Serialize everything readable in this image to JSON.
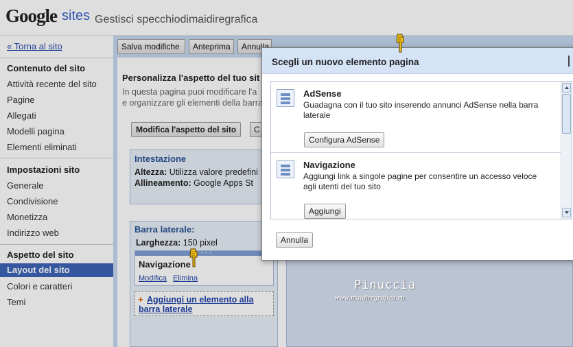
{
  "header": {
    "logo_brand": "Google",
    "logo_product": "sites",
    "site_title": "Gestisci specchiodimaidiregrafica"
  },
  "sidebar": {
    "back_link": "« Torna al sito",
    "content_heading": "Contenuto del sito",
    "content_items": [
      "Attività recente del sito",
      "Pagine",
      "Allegati",
      "Modelli pagina",
      "Elementi eliminati"
    ],
    "settings_heading": "Impostazioni sito",
    "settings_items": [
      "Generale",
      "Condivisione",
      "Monetizza",
      "Indirizzo web"
    ],
    "appearance_heading": "Aspetto del sito",
    "appearance_items": [
      "Layout del sito",
      "Colori e caratteri",
      "Temi"
    ],
    "active_item": "Layout del sito"
  },
  "toolbar": {
    "save_label": "Salva modifiche",
    "preview_label": "Anteprima",
    "cancel_label": "Annulla"
  },
  "layout_page": {
    "title": "Personalizza l'aspetto del tuo sit",
    "description_line1": "In questa pagina puoi modificare l'a",
    "description_line2": "e organizzare gli elementi della barra",
    "modify_button": "Modifica l'aspetto del sito",
    "modify_button2": "C",
    "header_box": {
      "title": "Intestazione",
      "height_label": "Altezza:",
      "height_value": "Utilizza valore predefini",
      "alignment_label": "Allineamento:",
      "alignment_value": "Google Apps St"
    },
    "sidebar_box": {
      "title": "Barra laterale:",
      "width_label": "Larghezza:",
      "width_value": "150 pixel",
      "gadget_title": "Navigazione",
      "gadget_edit": "Modifica",
      "gadget_delete": "Elimina",
      "add_item": "Aggiungi un elemento alla barra laterale"
    }
  },
  "watermark": {
    "name": "Pinuccia",
    "url": "www.maidiregrafica.eu"
  },
  "dialog": {
    "title": "Scegli un nuovo elemento pagina",
    "items": [
      {
        "title": "AdSense",
        "description": "Guadagna con il tuo sito inserendo annunci AdSense nella barra laterale",
        "button": "Configura AdSense"
      },
      {
        "title": "Navigazione",
        "description": "Aggiungi link a singole pagine per consentire un accesso veloce agli utenti del tuo sito",
        "button": "Aggiungi"
      }
    ],
    "cancel_label": "Annulla"
  },
  "colors": {
    "accent": "#3c64b8",
    "main_bg": "#c5d7ef",
    "dialog_header": "#d5e3f7",
    "link": "#2244aa"
  }
}
